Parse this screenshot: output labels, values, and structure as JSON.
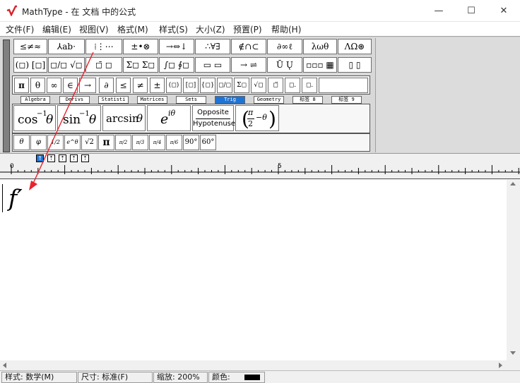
{
  "titlebar": {
    "title": "MathType - 在 文档 中的公式",
    "minimize": "—",
    "maximize": "☐",
    "close": "✕"
  },
  "menus": [
    "文件(F)",
    "编辑(E)",
    "视图(V)",
    "格式(M)",
    "样式(S)",
    "大小(Z)",
    "预置(P)",
    "帮助(H)"
  ],
  "palette_row1": [
    "≤≠≈",
    "⅄ab⋅",
    "⁞⋮⋯",
    "±•⊗",
    "→⇔↓",
    "∴∀∃",
    "∉∩⊂",
    "∂∞ℓ",
    "λωθ",
    "ΛΩ⊛"
  ],
  "palette_row2": [
    "(◻) [◻]",
    "◻/◻ √◻",
    "◻̄ ◻",
    "Σ◻ Σ◻",
    "∫◻ ∮◻",
    "▭ ▭",
    "→ ⇌",
    "Ū Ų",
    "▫▫▫ ▦",
    "▯ ▯"
  ],
  "palette_row3": [
    "π",
    "θ",
    "∞",
    "∈",
    "→",
    "∂",
    "≤",
    "≠",
    "±",
    "(◻)",
    "[◻]",
    "{◻}",
    "◻/◻",
    "Σ◻",
    "√◻",
    "◻̈",
    "◻.",
    "◻."
  ],
  "tabs": [
    "Algebra",
    "Derivs",
    "Statisti",
    "Matrices",
    "Sets",
    "Trig",
    "Geometry",
    "标签 8",
    "标签 9"
  ],
  "active_tab": "Trig",
  "trig_templates": {
    "cos_inv": "cos",
    "sin_inv": "sin",
    "inv_exp": "−1",
    "theta": "θ",
    "arcsin": "arcsin",
    "e": "e",
    "itheta": "iθ",
    "opposite": "Opposite",
    "hypotenuse": "Hypotenuse",
    "pi": "π",
    "two": "2",
    "minus_theta": "−θ"
  },
  "small_row": [
    "θ",
    "φ",
    "1/2",
    "e^θ",
    "√2",
    "π",
    "π/2",
    "π/3",
    "π/4",
    "π/6",
    "90°",
    "60°"
  ],
  "ruler": {
    "mark_zero": "0",
    "mark_five": "5"
  },
  "equation": {
    "text": "f′"
  },
  "statusbar": {
    "style": "样式: 数学(M)",
    "size": "尺寸: 标准(F)",
    "zoom": "缩放: 200%",
    "color": "颜色:"
  },
  "colors": {
    "accent": "#1e74d6",
    "arrow": "#e8242e"
  }
}
